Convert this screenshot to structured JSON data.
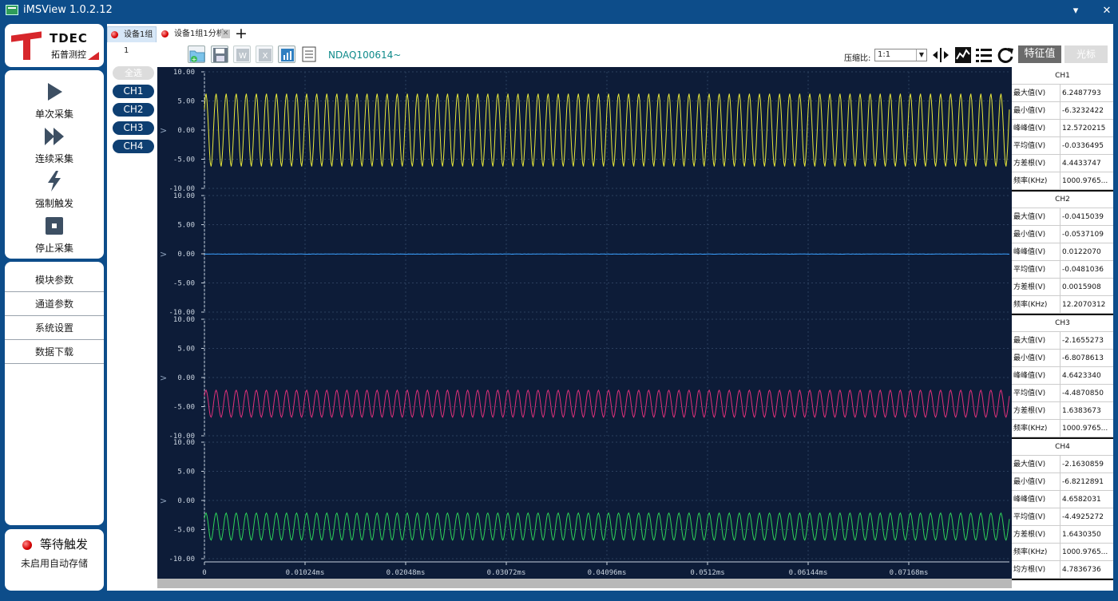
{
  "window": {
    "title": "iMSView 1.0.2.12",
    "min_btn": "▾",
    "close_btn": "✕"
  },
  "logo": {
    "brand": "TDEC",
    "subtitle": "拓普测控"
  },
  "acquisition": {
    "single": "单次采集",
    "continuous": "连续采集",
    "force_trigger": "强制触发",
    "stop": "停止采集"
  },
  "menu": [
    "模块参数",
    "通道参数",
    "系统设置",
    "数据下载"
  ],
  "status": {
    "title": "等待触发",
    "subtitle": "未启用自动存储"
  },
  "tabs": [
    {
      "label": "设备1组1",
      "active": true
    },
    {
      "label": "设备1组1分析",
      "active": false
    }
  ],
  "add_tab": "+",
  "device_name": "NDAQ100614~",
  "toolbar": {
    "ratio_label": "压缩比:",
    "ratio_value": "1:1",
    "feature_btn": "特征值",
    "cursor_btn": "光标"
  },
  "channel_buttons": {
    "all": "全选",
    "channels": [
      "CH1",
      "CH2",
      "CH3",
      "CH4"
    ]
  },
  "colors": {
    "ch1": "#e8e83a",
    "ch2": "#3aa0ff",
    "ch3": "#e0307a",
    "ch4": "#2ed35a",
    "plot_bg": "#0d1c38"
  },
  "chart_data": {
    "type": "line",
    "x_ticks": [
      "0",
      "0.01024ms",
      "0.02048ms",
      "0.03072ms",
      "0.04096ms",
      "0.0512ms",
      "0.06144ms",
      "0.07168ms"
    ],
    "y_ticks": [
      "10.00",
      "5.00",
      "0.00",
      "-5.00",
      "-10.00"
    ],
    "ylim": [
      -10,
      10
    ],
    "panels": [
      {
        "name": "CH1",
        "center": 0.0,
        "amplitude": 6.25,
        "cycles": 80,
        "noise": 0
      },
      {
        "name": "CH2",
        "center": -0.048,
        "amplitude": 0.05,
        "cycles": 0,
        "noise": 0.05
      },
      {
        "name": "CH3",
        "center": -4.49,
        "amplitude": 2.32,
        "cycles": 80,
        "noise": 0
      },
      {
        "name": "CH4",
        "center": -4.49,
        "amplitude": 2.33,
        "cycles": 80,
        "noise": 0
      }
    ]
  },
  "stats": [
    {
      "channel": "CH1",
      "rows": [
        [
          "最大值(V)",
          "6.2487793"
        ],
        [
          "最小值(V)",
          "-6.3232422"
        ],
        [
          "峰峰值(V)",
          "12.5720215"
        ],
        [
          "平均值(V)",
          "-0.0336495"
        ],
        [
          "方差根(V)",
          "4.4433747"
        ],
        [
          "频率(KHz)",
          "1000.9765..."
        ]
      ]
    },
    {
      "channel": "CH2",
      "rows": [
        [
          "最大值(V)",
          "-0.0415039"
        ],
        [
          "最小值(V)",
          "-0.0537109"
        ],
        [
          "峰峰值(V)",
          "0.0122070"
        ],
        [
          "平均值(V)",
          "-0.0481036"
        ],
        [
          "方差根(V)",
          "0.0015908"
        ],
        [
          "频率(KHz)",
          "12.2070312"
        ]
      ]
    },
    {
      "channel": "CH3",
      "rows": [
        [
          "最大值(V)",
          "-2.1655273"
        ],
        [
          "最小值(V)",
          "-6.8078613"
        ],
        [
          "峰峰值(V)",
          "4.6423340"
        ],
        [
          "平均值(V)",
          "-4.4870850"
        ],
        [
          "方差根(V)",
          "1.6383673"
        ],
        [
          "频率(KHz)",
          "1000.9765..."
        ]
      ]
    },
    {
      "channel": "CH4",
      "rows": [
        [
          "最大值(V)",
          "-2.1630859"
        ],
        [
          "最小值(V)",
          "-6.8212891"
        ],
        [
          "峰峰值(V)",
          "4.6582031"
        ],
        [
          "平均值(V)",
          "-4.4925272"
        ],
        [
          "方差根(V)",
          "1.6430350"
        ],
        [
          "频率(KHz)",
          "1000.9765..."
        ],
        [
          "均方根(V)",
          "4.7836736"
        ]
      ]
    }
  ]
}
